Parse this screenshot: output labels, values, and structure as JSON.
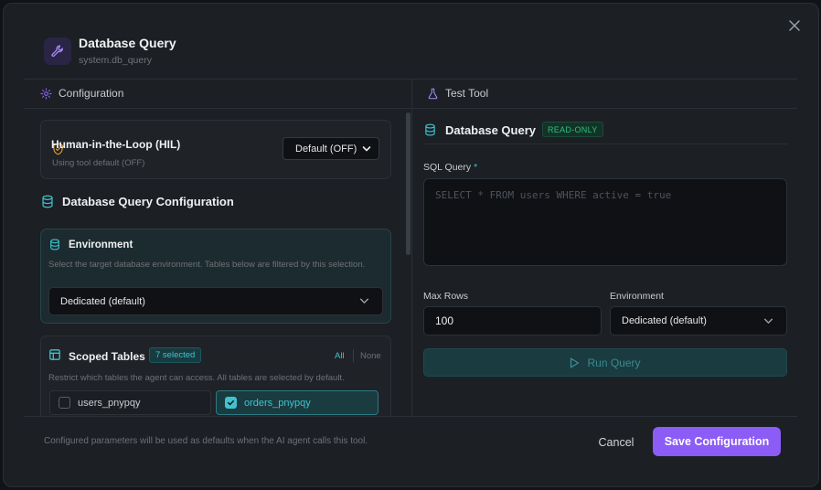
{
  "dialog": {
    "title": "Database Query",
    "subtitle": "system.db_query",
    "icon": "wrench-icon"
  },
  "left": {
    "section_label": "Configuration",
    "hil": {
      "title": "Human-in-the-Loop (HIL)",
      "subtitle": "Using tool default (OFF)",
      "select_value": "Default (OFF)"
    },
    "config_title": "Database Query Configuration",
    "environment": {
      "title": "Environment",
      "description": "Select the target database environment. Tables below are filtered by this selection.",
      "select_value": "Dedicated (default)"
    },
    "scoped": {
      "title": "Scoped Tables",
      "badge": "7 selected",
      "all": "All",
      "none": "None",
      "description": "Restrict which tables the agent can access. All tables are selected by default.",
      "tables": [
        {
          "name": "users_pnypqy",
          "checked": false
        },
        {
          "name": "orders_pnypqy",
          "checked": true
        }
      ]
    }
  },
  "right": {
    "section_label": "Test Tool",
    "title": "Database Query",
    "badge": "READ-ONLY",
    "sql_label": "SQL Query",
    "sql_required": "*",
    "sql_placeholder": "SELECT * FROM users WHERE active = true",
    "max_rows_label": "Max Rows",
    "max_rows_value": "100",
    "env_label": "Environment",
    "env_value": "Dedicated (default)",
    "run_label": "Run Query"
  },
  "footer": {
    "note": "Configured parameters will be used as defaults when the AI agent calls this tool.",
    "cancel": "Cancel",
    "save": "Save Configuration"
  },
  "colors": {
    "accent_purple": "#8b5cf6",
    "accent_teal": "#3fc4cf",
    "readonly_green": "#2fbf7f",
    "background": "#1c1f24"
  }
}
